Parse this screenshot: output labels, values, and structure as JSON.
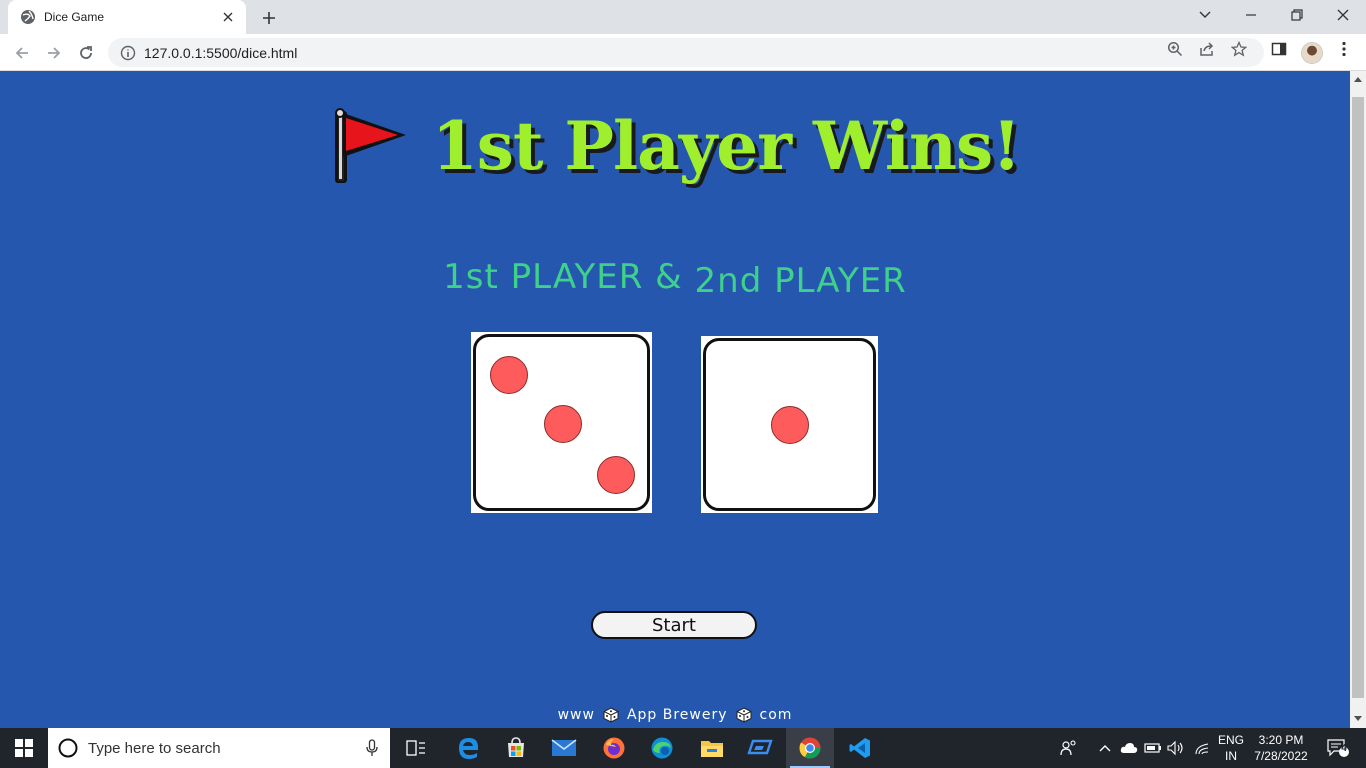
{
  "browser": {
    "tab_title": "Dice Game",
    "url": "127.0.0.1:5500/dice.html"
  },
  "page": {
    "headline": "1st Player Wins!",
    "player1_label": "1st PLAYER &",
    "player2_label": "2nd PLAYER",
    "die1_value": 3,
    "die2_value": 1,
    "start_label": "Start",
    "footer": {
      "left": "www",
      "middle": "App Brewery",
      "right": "com"
    },
    "colors": {
      "background": "#2557af",
      "headline": "#a0ef2e",
      "players": "#3fd08c",
      "pip": "#fe5c5c",
      "flag": "#e8141b"
    }
  },
  "taskbar": {
    "search_placeholder": "Type here to search",
    "lang_top": "ENG",
    "lang_bottom": "IN",
    "time": "3:20 PM",
    "date": "7/28/2022",
    "notification_count": "4"
  }
}
